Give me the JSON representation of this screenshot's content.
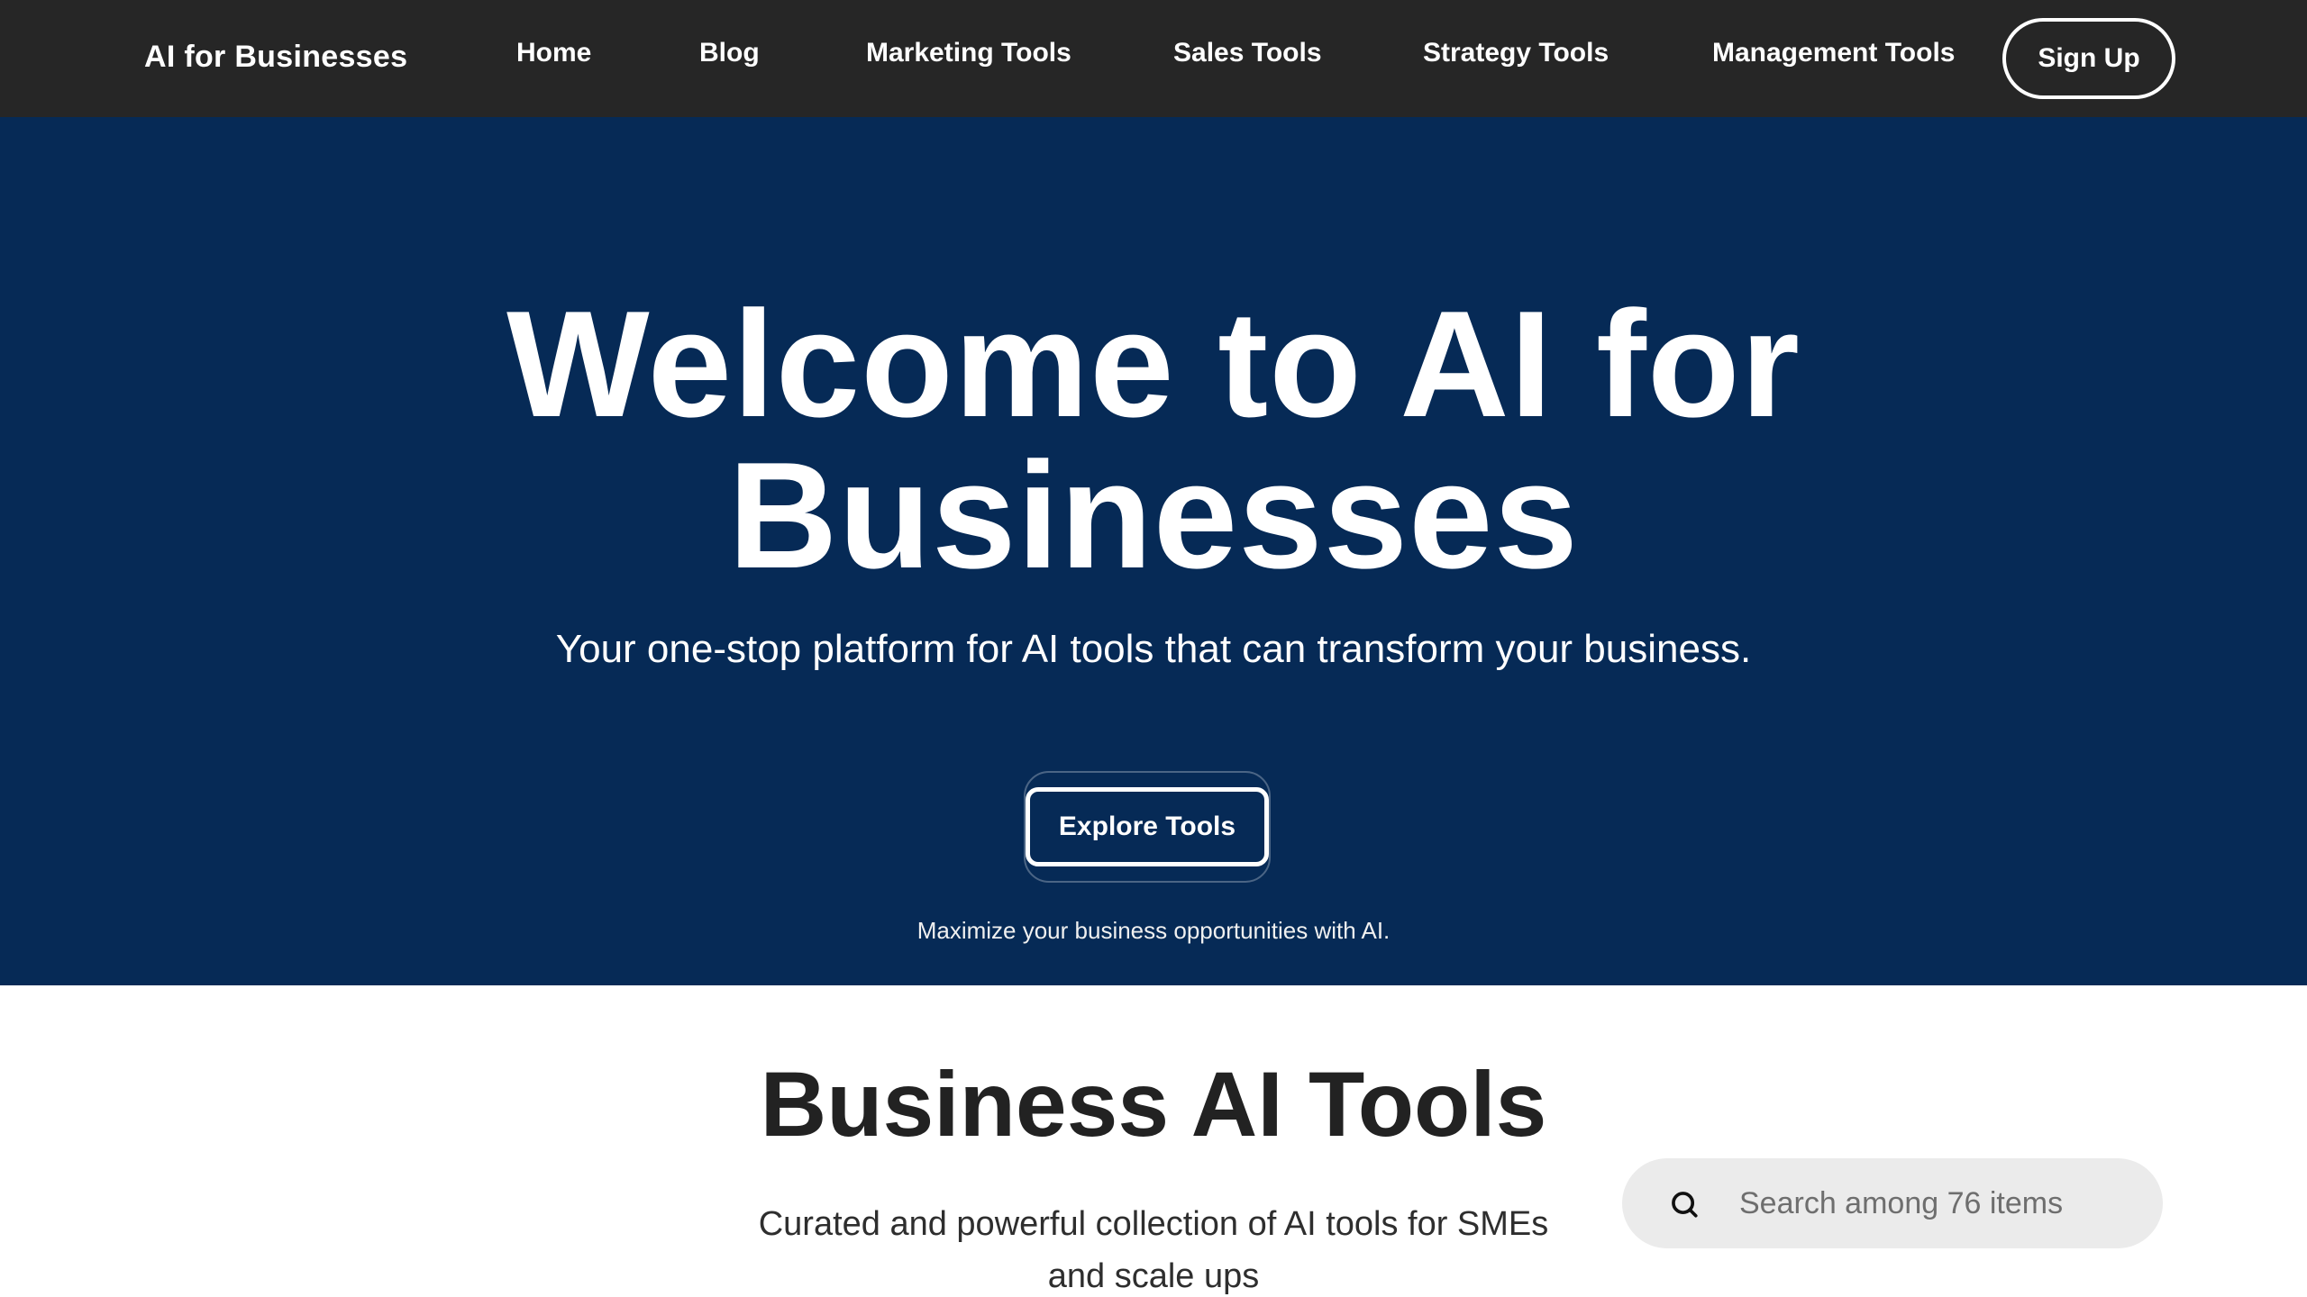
{
  "nav": {
    "brand": "AI for Businesses",
    "links": [
      "Home",
      "Blog",
      "Marketing Tools",
      "Sales Tools",
      "Strategy Tools",
      "Management Tools"
    ],
    "signup_label": "Sign Up"
  },
  "hero": {
    "title_line1": "Welcome to AI for",
    "title_line2": "Businesses",
    "subtitle": "Your one-stop platform for AI tools that can transform your business.",
    "cta_label": "Explore Tools",
    "tagline": "Maximize your business opportunities with AI."
  },
  "tools_section": {
    "title": "Business AI Tools",
    "description": "Curated and powerful collection of AI tools for SMEs and scale ups",
    "search": {
      "icon": "search-icon",
      "placeholder": "Search among 76 items",
      "value": ""
    }
  },
  "colors": {
    "nav_bg": "#262626",
    "hero_bg": "#062a56",
    "search_bg": "#ebebeb",
    "heading_text": "#222222"
  }
}
